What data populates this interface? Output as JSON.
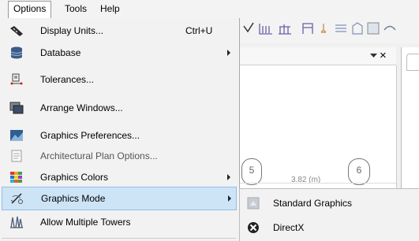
{
  "menubar": {
    "items": [
      "Options",
      "Tools",
      "Help"
    ]
  },
  "menu": {
    "items": [
      {
        "label": "Display Units...",
        "shortcut": "Ctrl+U",
        "icon": "ruler-icon"
      },
      {
        "label": "Database",
        "icon": "database-icon"
      },
      {
        "label": "Tolerances...",
        "icon": "tolerance-icon"
      },
      {
        "label": "Arrange Windows...",
        "icon": "windows-icon"
      },
      {
        "label": "Graphics Preferences...",
        "icon": "graphics-preferences-icon"
      },
      {
        "label": "Architectural Plan Options...",
        "icon": "document-icon"
      },
      {
        "label": "Graphics Colors",
        "icon": "color-grid-icon"
      },
      {
        "label": "Graphics Mode",
        "icon": "graphics-mode-icon"
      },
      {
        "label": "Allow Multiple Towers",
        "icon": "towers-icon"
      }
    ]
  },
  "submenu": {
    "items": [
      {
        "label": "Standard Graphics",
        "icon": "standard-graphics-icon"
      },
      {
        "label": "DirectX",
        "icon": "directx-icon"
      }
    ]
  },
  "canvas": {
    "grid_labels": [
      "5",
      "6"
    ],
    "dimension": "3.82 (m)"
  },
  "panel": {
    "close_symbol": "×"
  },
  "colors": {
    "selection": "#cde4f7",
    "menu_bg": "#f2f2f2"
  }
}
